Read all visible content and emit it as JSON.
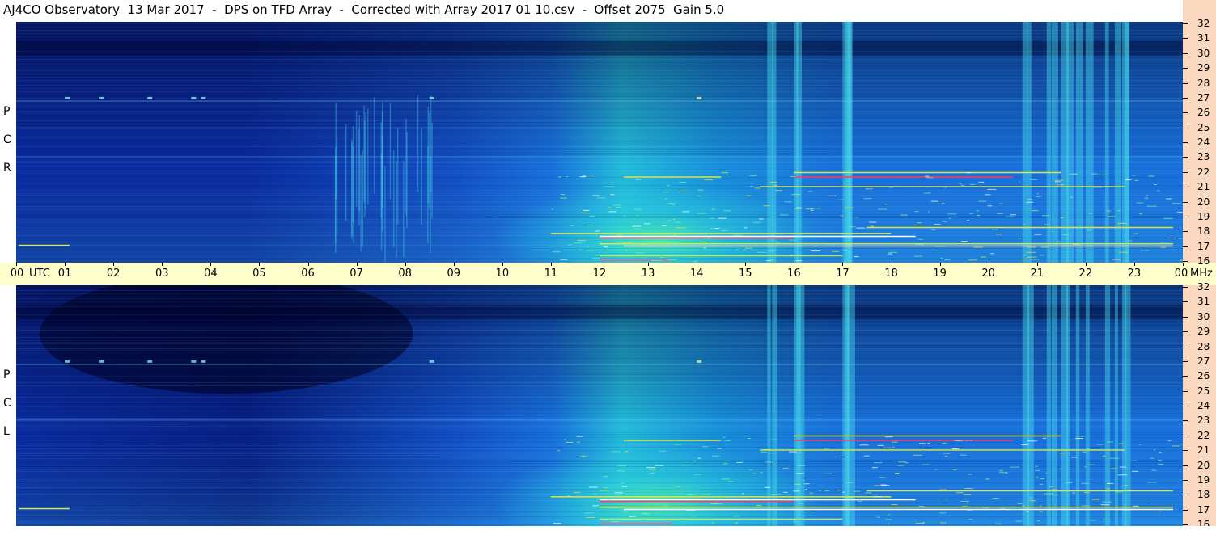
{
  "title": "AJ4CO Observatory  13 Mar 2017  -  DPS on TFD Array  -  Corrected with Array 2017 01 10.csv  -  Offset 2075  Gain 5.0",
  "chart_data": [
    {
      "type": "heatmap",
      "panel": "RCP",
      "side_label": [
        "R",
        "C",
        "P"
      ],
      "x_unit": "UTC hour",
      "x_ticks": [
        "00",
        "01",
        "02",
        "03",
        "04",
        "05",
        "06",
        "07",
        "08",
        "09",
        "10",
        "11",
        "12",
        "13",
        "14",
        "15",
        "16",
        "17",
        "18",
        "19",
        "20",
        "21",
        "22",
        "23",
        "00"
      ],
      "y_unit": "MHz",
      "y_ticks": [
        "16",
        "17",
        "18",
        "19",
        "20",
        "21",
        "22",
        "23",
        "24",
        "25",
        "26",
        "27",
        "28",
        "29",
        "30",
        "31",
        "32"
      ],
      "ylim": [
        16,
        32
      ],
      "colormap": [
        "#00003a",
        "#0b2fa6",
        "#1a78e6",
        "#25c8e6",
        "#3fe0a0",
        "#d8e84a",
        "#ff3a3a",
        "#ffffff"
      ]
    },
    {
      "type": "heatmap",
      "panel": "LCP",
      "side_label": [
        "L",
        "C",
        "P"
      ],
      "x_unit": "UTC hour",
      "x_ticks": [
        "00",
        "01",
        "02",
        "03",
        "04",
        "05",
        "06",
        "07",
        "08",
        "09",
        "10",
        "11",
        "12",
        "13",
        "14",
        "15",
        "16",
        "17",
        "18",
        "19",
        "20",
        "21",
        "22",
        "23",
        "00"
      ],
      "y_unit": "MHz",
      "y_ticks": [
        "16",
        "17",
        "18",
        "19",
        "20",
        "21",
        "22",
        "23",
        "24",
        "25",
        "26",
        "27",
        "28",
        "29",
        "30",
        "31",
        "32"
      ],
      "ylim": [
        16,
        32
      ],
      "colormap": [
        "#00003a",
        "#0b2fa6",
        "#1a78e6",
        "#25c8e6",
        "#3fe0a0",
        "#d8e84a",
        "#ff3a3a",
        "#ffffff"
      ]
    }
  ],
  "time_axis": {
    "utc_label": "UTC",
    "mhz_label": "MHz",
    "ticks": [
      "00",
      "01",
      "02",
      "03",
      "04",
      "05",
      "06",
      "07",
      "08",
      "09",
      "10",
      "11",
      "12",
      "13",
      "14",
      "15",
      "16",
      "17",
      "18",
      "19",
      "20",
      "21",
      "22",
      "23",
      "00"
    ]
  }
}
